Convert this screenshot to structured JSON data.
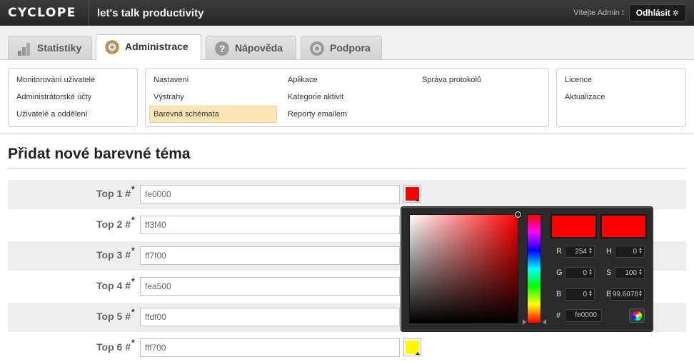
{
  "header": {
    "logo": "CYCLOPE",
    "tagline": "let's talk productivity",
    "welcome": "Vítejte Admin !",
    "logout_label": "Odhlásit"
  },
  "tabs": [
    {
      "label": "Statistiky",
      "icon": "bar-chart-icon",
      "active": false
    },
    {
      "label": "Administrace",
      "icon": "gear-icon",
      "active": true
    },
    {
      "label": "Nápověda",
      "icon": "help-icon",
      "active": false
    },
    {
      "label": "Podpora",
      "icon": "support-icon",
      "active": false
    }
  ],
  "submenu": {
    "left": [
      "Monitorování uživatelé",
      "Administrátorské účty",
      "Uživatelé a oddělení"
    ],
    "middle_col1": [
      "Nastavení",
      "Výstrahy",
      "Barevná schémata"
    ],
    "middle_col2": [
      "Aplikace",
      "Kategorie aktivit",
      "Reporty emailem"
    ],
    "middle_col3": [
      "Správa protokolů"
    ],
    "right": [
      "Licence",
      "Aktualizace"
    ],
    "active_item": "Barevná schémata"
  },
  "page": {
    "title": "Přidat nové barevné téma"
  },
  "rows": [
    {
      "label": "Top 1 #",
      "value": "fe0000",
      "swatch": "#fe0000"
    },
    {
      "label": "Top 2 #",
      "value": "ff3f40",
      "swatch": "#ff3f40"
    },
    {
      "label": "Top 3 #",
      "value": "ff7f00",
      "swatch": "#ff7f00"
    },
    {
      "label": "Top 4 #",
      "value": "fea500",
      "swatch": "#fea500"
    },
    {
      "label": "Top 5 #",
      "value": "ffdf00",
      "swatch": "#ffdf00"
    },
    {
      "label": "Top 6 #",
      "value": "fff700",
      "swatch": "#fff700"
    }
  ],
  "required_mark": "*",
  "picker": {
    "current_color": "#fe0000",
    "previous_color": "#fe0000",
    "r_label": "R",
    "r": "254",
    "g_label": "G",
    "g": "0",
    "b_label": "B",
    "b": "0",
    "h_label": "H",
    "h": "0",
    "s_label": "S",
    "s": "100",
    "br_label": "B",
    "br": "99.6078",
    "hex_label": "#",
    "hex": "fe0000"
  }
}
